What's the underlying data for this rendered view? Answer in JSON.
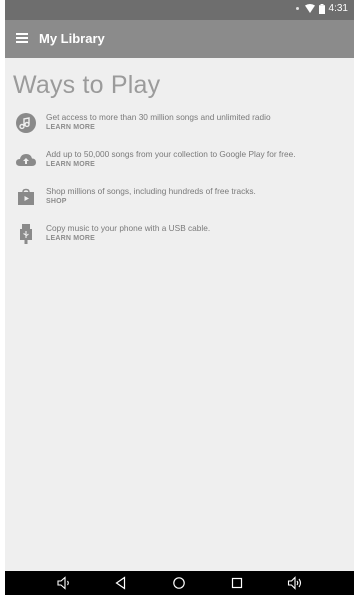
{
  "status_bar": {
    "time": "4:31"
  },
  "app_bar": {
    "title": "My Library"
  },
  "content": {
    "section_title": "Ways to Play",
    "options": [
      {
        "icon": "music-note-icon",
        "text": "Get access to more than 30 million songs and unlimited radio",
        "link": "LEARN MORE"
      },
      {
        "icon": "cloud-upload-icon",
        "text": "Add up to 50,000 songs from your collection to Google Play for free.",
        "link": "LEARN MORE"
      },
      {
        "icon": "shopping-bag-icon",
        "text": "Shop millions of songs, including hundreds of free tracks.",
        "link": "SHOP"
      },
      {
        "icon": "usb-icon",
        "text": "Copy music to your phone with a USB cable.",
        "link": "LEARN MORE"
      }
    ]
  },
  "nav_bar": {
    "buttons": [
      "volume-down-icon",
      "back-icon",
      "home-icon",
      "recents-icon",
      "volume-up-icon"
    ]
  },
  "colors": {
    "status_bar": "#6e6e6e",
    "app_bar": "#8b8b8b",
    "background": "#efefef",
    "icon_gray": "#8a8a8a",
    "nav_bar": "#000000"
  }
}
